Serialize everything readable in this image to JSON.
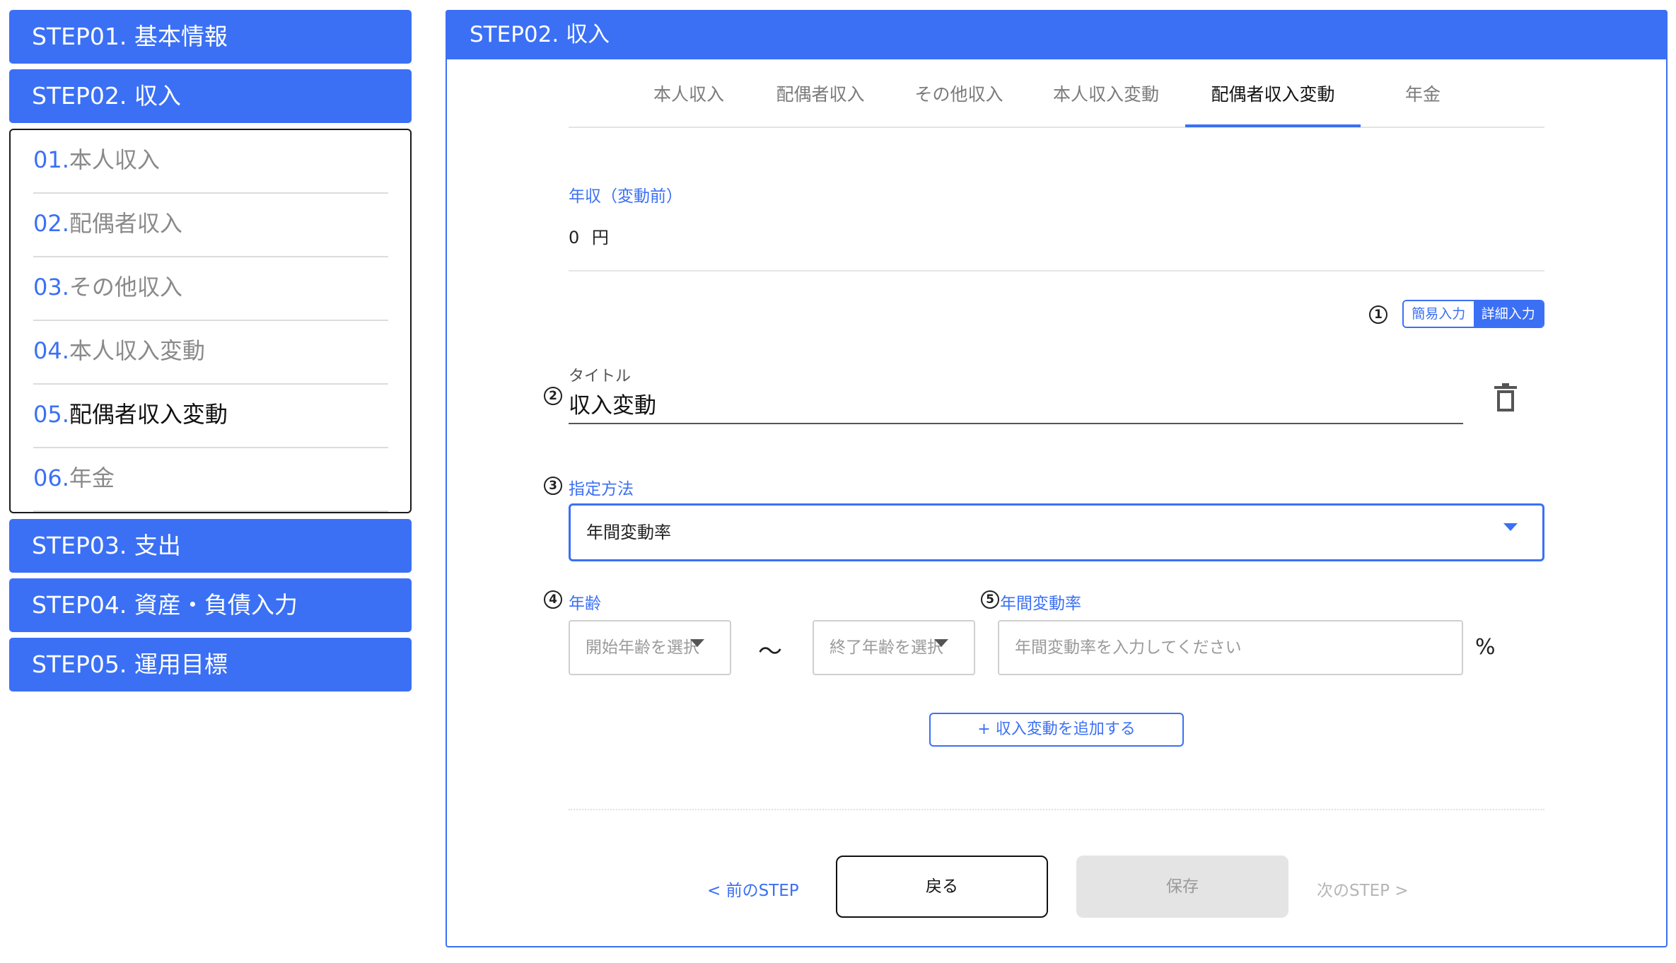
{
  "sidebar": {
    "steps_top": [
      {
        "label": "STEP01. 基本情報"
      },
      {
        "label": "STEP02. 収入"
      }
    ],
    "sub_items": [
      {
        "num": "01.",
        "label": "本人収入",
        "active": false
      },
      {
        "num": "02.",
        "label": "配偶者収入",
        "active": false
      },
      {
        "num": "03.",
        "label": "その他収入",
        "active": false
      },
      {
        "num": "04.",
        "label": "本人収入変動",
        "active": false
      },
      {
        "num": "05.",
        "label": "配偶者収入変動",
        "active": true
      },
      {
        "num": "06.",
        "label": "年金",
        "active": false
      }
    ],
    "steps_bottom": [
      {
        "label": "STEP03. 支出"
      },
      {
        "label": "STEP04. 資産・負債入力"
      },
      {
        "label": "STEP05. 運用目標"
      }
    ]
  },
  "panel": {
    "title": "STEP02. 収入",
    "tabs": [
      {
        "label": "本人収入"
      },
      {
        "label": "配偶者収入"
      },
      {
        "label": "その他収入"
      },
      {
        "label": "本人収入変動"
      },
      {
        "label": "配偶者収入変動",
        "active": true
      },
      {
        "label": "年金"
      }
    ]
  },
  "income": {
    "label": "年収（変動前）",
    "value": "0",
    "unit": "円"
  },
  "markers": {
    "m1": "1",
    "m2": "2",
    "m3": "3",
    "m4": "4",
    "m5": "5"
  },
  "input_mode": {
    "simple": "簡易入力",
    "detailed": "詳細入力",
    "selected": "詳細入力"
  },
  "title_field": {
    "label": "タイトル",
    "value": "収入変動"
  },
  "method": {
    "label": "指定方法",
    "value": "年間変動率"
  },
  "age": {
    "label": "年齢",
    "start_placeholder": "開始年齢を選択",
    "end_placeholder": "終了年齢を選択",
    "separator": "〜"
  },
  "rate": {
    "label": "年間変動率",
    "placeholder": "年間変動率を入力してください",
    "unit": "%"
  },
  "actions": {
    "add": "+ 収入変動を追加する",
    "prev": "< 前のSTEP",
    "back": "戻る",
    "save": "保存",
    "next": "次のSTEP >"
  },
  "colors": {
    "primary": "#3b70f5",
    "disabled_bg": "#e4e4e4",
    "muted_text": "#8a8a8a"
  },
  "icons": {
    "delete": "trash-icon",
    "dropdown": "caret-down-icon"
  }
}
